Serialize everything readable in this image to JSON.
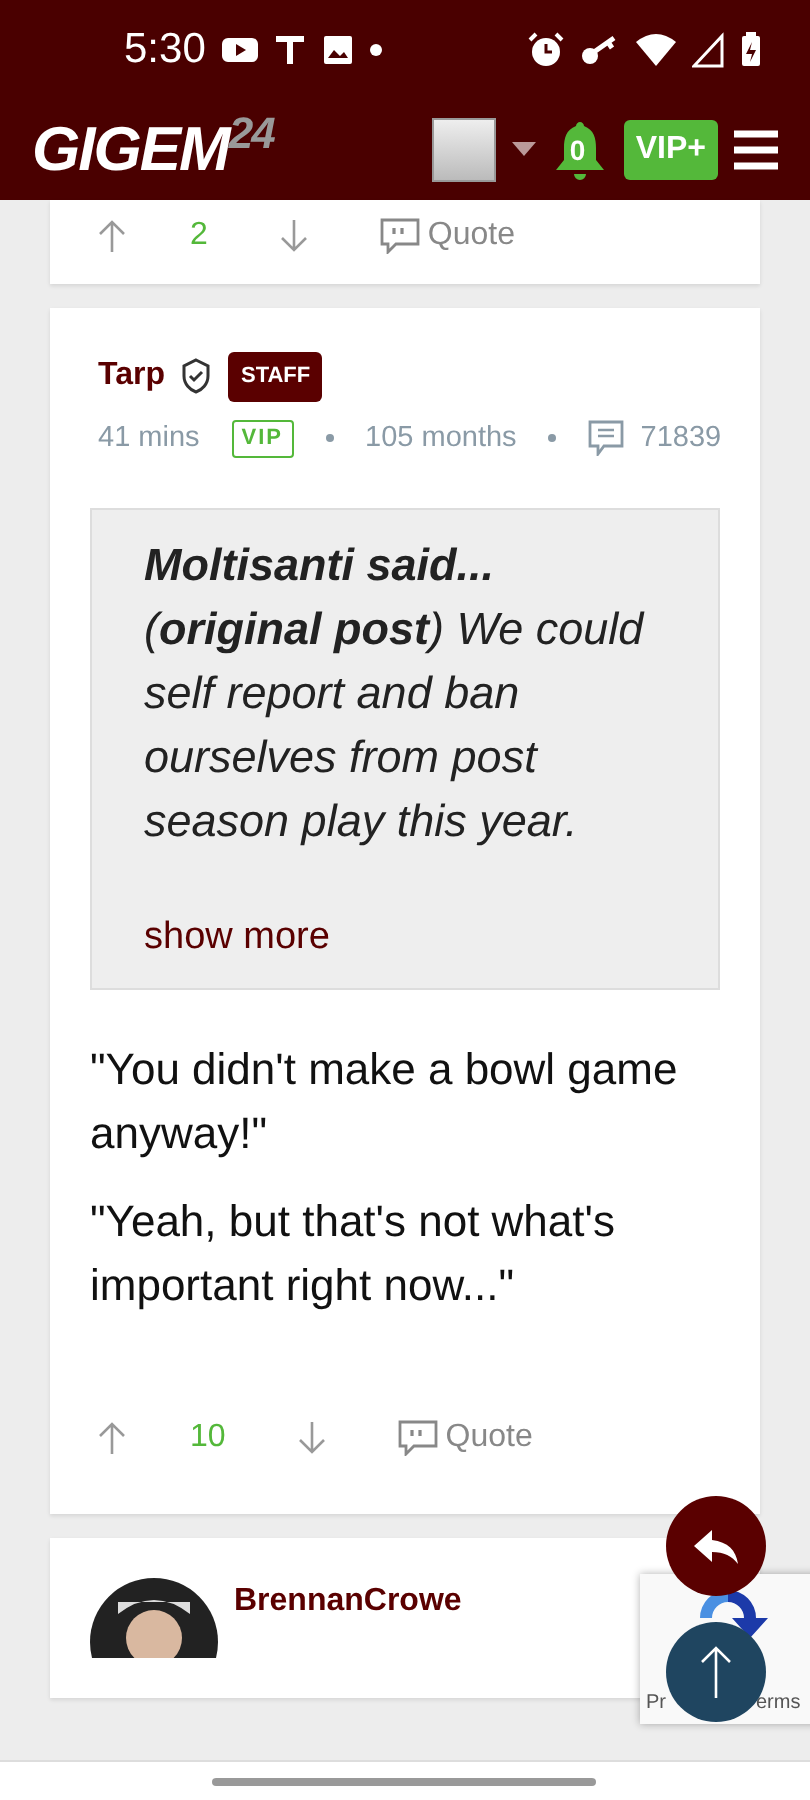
{
  "status_bar": {
    "time": "5:30"
  },
  "header": {
    "logo": "GIGEM",
    "logo_suffix": "24",
    "notifications": "0",
    "vip_button": "VIP+"
  },
  "posts": [
    {
      "kind": "tail",
      "votes": "2",
      "quote_label": "Quote"
    },
    {
      "kind": "full",
      "author": "Tarp",
      "badge": "STAFF",
      "time": "41 mins",
      "tier": "VIP",
      "tenure": "105 months",
      "post_count": "71839",
      "quote": {
        "text": "**Moltisanti said...** (**original post**) We could self report and ban ourselves from post season play this year.",
        "more": "show more"
      },
      "paragraphs": [
        "\"You didn't make a bowl game anyway!\"",
        "\"Yeah, but that's not what's important right now...\""
      ],
      "votes": "10",
      "quote_label": "Quote"
    },
    {
      "kind": "head",
      "author": "BrennanCrowe"
    }
  ],
  "recaptcha": {
    "left": "Pr",
    "right": "erms"
  }
}
